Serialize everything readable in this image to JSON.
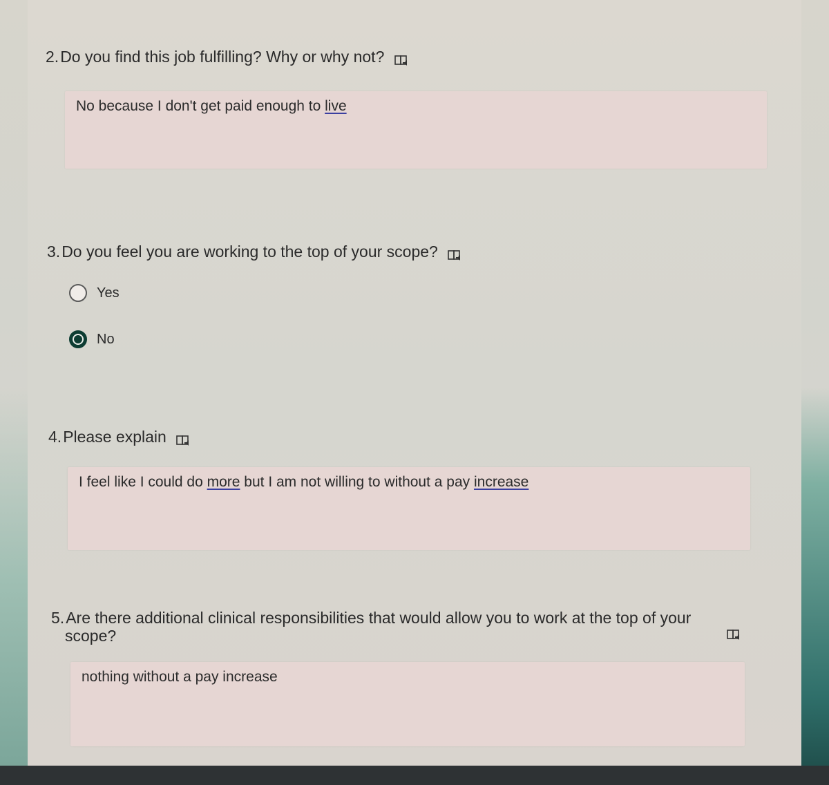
{
  "questions": [
    {
      "number": "2.",
      "title": "Do you find this job fulfilling? Why or why not?",
      "answer_plain": "No because I don't get paid enough to ",
      "answer_underlined": "live"
    },
    {
      "number": "3.",
      "title": "Do you feel you are working to the top of your scope?",
      "options": [
        {
          "label": "Yes",
          "selected": false
        },
        {
          "label": "No",
          "selected": true
        }
      ]
    },
    {
      "number": "4.",
      "title": "Please explain",
      "answer_part1": "I feel like I could do ",
      "answer_u1": "more",
      "answer_part2": " but I am not willing to without a pay ",
      "answer_u2": "increase"
    },
    {
      "number": "5.",
      "title_line1": "Are there additional clinical responsibilities that would allow you to work at the top of your",
      "title_line2": "scope?",
      "answer": "nothing without a pay increase"
    }
  ],
  "icons": {
    "immersive_reader": "immersive-reader-icon",
    "radio_checked_color": "#0d3d33",
    "answer_box_color": "#e6d6d3"
  }
}
